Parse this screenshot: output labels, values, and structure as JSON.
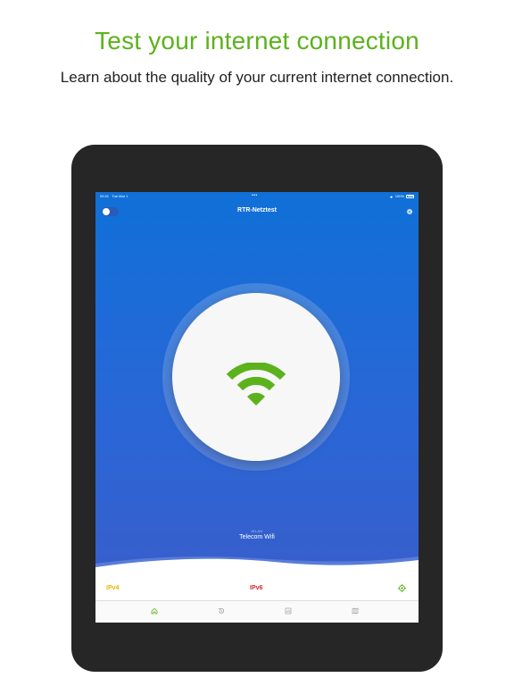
{
  "headline": "Test your internet connection",
  "subline": "Learn about the quality of your current internet connection.",
  "statusbar": {
    "time": "09:41",
    "date": "Tue Mar 1",
    "center": "•••",
    "battery": "100%"
  },
  "navbar": {
    "title": "RTR-Netztest"
  },
  "network": {
    "type": "WLAN",
    "name": "Telecom Wifi"
  },
  "protocols": {
    "ipv4": "IPv4",
    "ipv6": "IPv6"
  },
  "tabs": [
    {
      "icon": "home-icon",
      "active": true
    },
    {
      "icon": "history-icon",
      "active": false
    },
    {
      "icon": "statistics-icon",
      "active": false
    },
    {
      "icon": "map-icon",
      "active": false
    }
  ],
  "colors": {
    "accent_green": "#5cb21c",
    "screen_blue": "#1070d8",
    "ipv4_yellow": "#e6b800",
    "ipv6_red": "#d9262b",
    "tab_inactive": "#999999"
  }
}
